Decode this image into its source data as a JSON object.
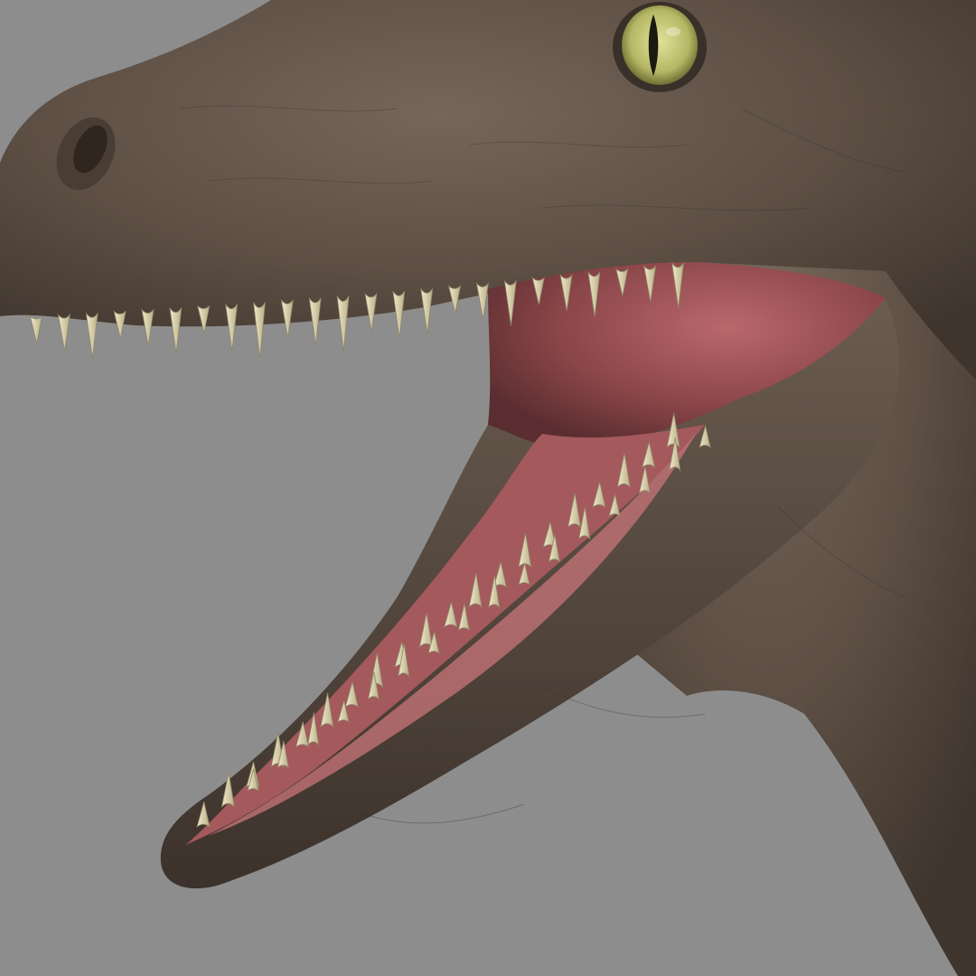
{
  "scene": {
    "subject": "dinosaur-head-render",
    "background_color": "#8d8d8d"
  },
  "colors": {
    "skin": "#5f5146",
    "skin_dark": "#3e342c",
    "skin_light": "#7a6a5d",
    "mouth_interior": "#8a4a4d",
    "tongue": "#a2585c",
    "gum": "#b76a6d",
    "tooth": "#e4dcb4",
    "tooth_shade": "#b9ad86",
    "eye_iris": "#c8c97a",
    "eye_pupil": "#1b1a10"
  },
  "icons": {
    "eye": "reptile-eye-icon",
    "nostril": "nostril-icon"
  }
}
